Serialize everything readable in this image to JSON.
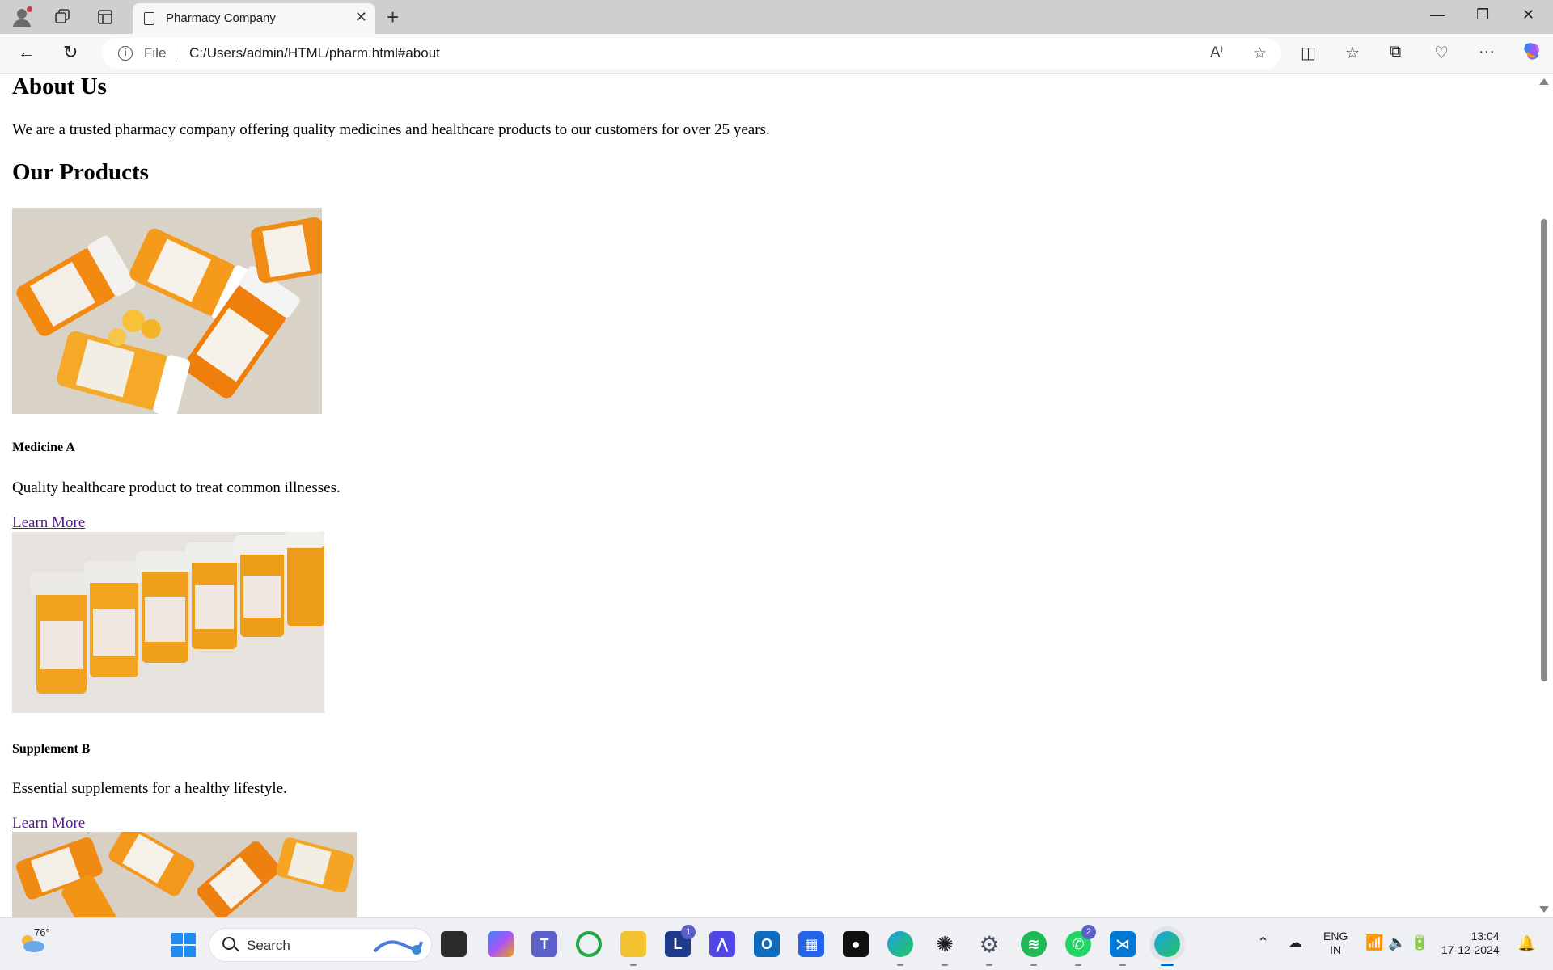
{
  "browser": {
    "tab_title": "Pharmacy Company",
    "address_scheme": "File",
    "url": "C:/Users/admin/HTML/pharm.html#about"
  },
  "page": {
    "about_heading": "About Us",
    "about_text": "We are a trusted pharmacy company offering quality medicines and healthcare products to our customers for over 25 years.",
    "products_heading": "Our Products",
    "products": [
      {
        "name": "Medicine A",
        "description": "Quality healthcare product to treat common illnesses.",
        "link": "Learn More"
      },
      {
        "name": "Supplement B",
        "description": "Essential supplements for a healthy lifestyle.",
        "link": "Learn More"
      }
    ]
  },
  "taskbar": {
    "weather_temp": "76°",
    "search_label": "Search",
    "lang_line1": "ENG",
    "lang_line2": "IN",
    "time": "13:04",
    "date": "17-12-2024",
    "badge_l": "1",
    "badge_whatsapp": "2"
  },
  "colors": {
    "link": "#551a8b",
    "accent": "#1f8bf0"
  }
}
